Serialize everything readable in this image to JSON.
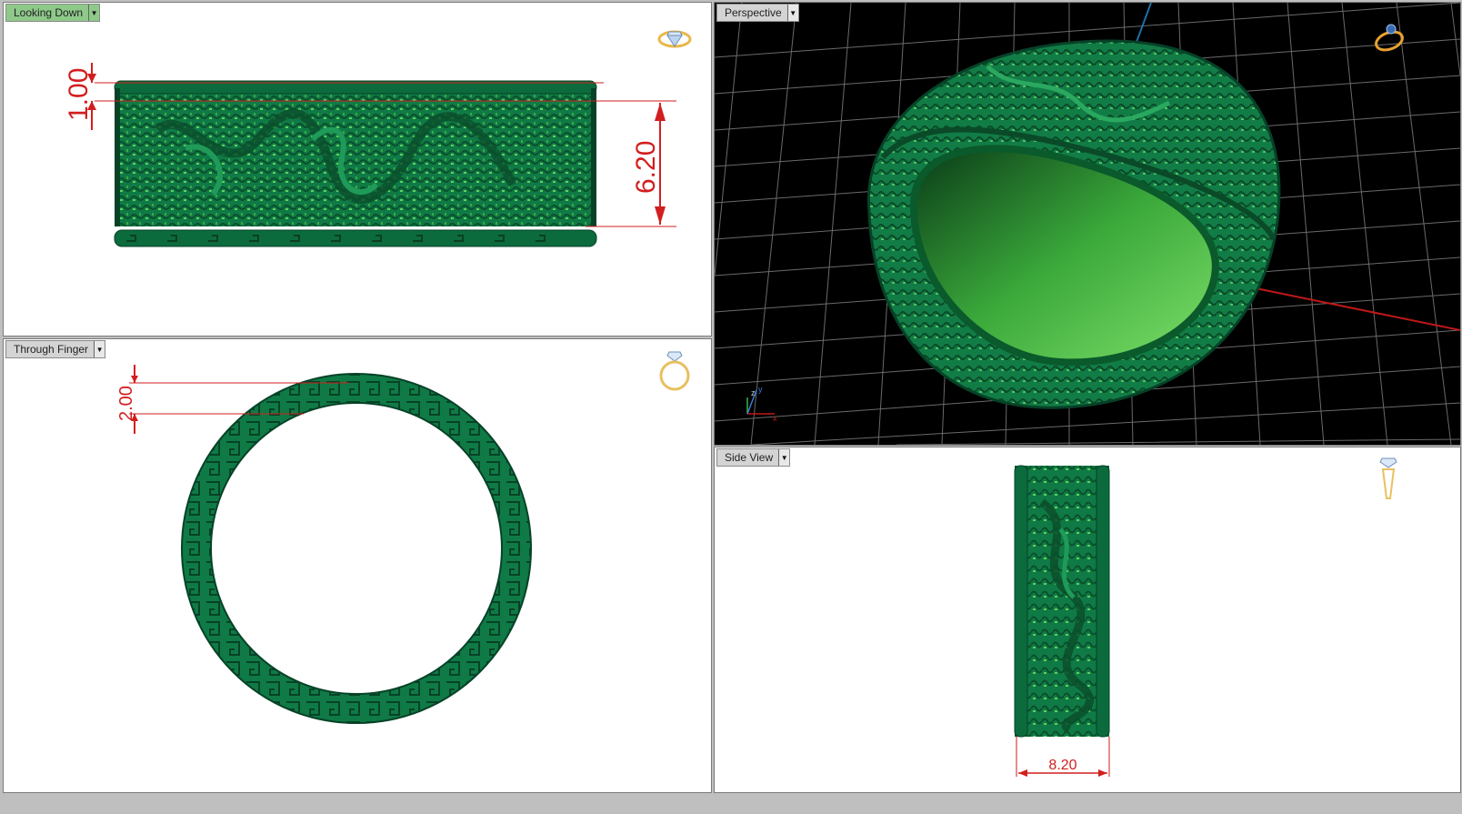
{
  "viewports": {
    "top_left": {
      "label": "Looking Down",
      "active": true
    },
    "top_right": {
      "label": "Perspective",
      "active": false
    },
    "bottom_left": {
      "label": "Through Finger",
      "active": false
    },
    "bottom_right": {
      "label": "Side View",
      "active": false
    }
  },
  "dimensions": {
    "edge_thickness": "1.00",
    "band_height": "6.20",
    "ring_thickness": "2.00",
    "band_width": "8.20"
  },
  "icons": {
    "top_left": "ring-top-view-icon",
    "top_right": "ring-perspective-icon",
    "bottom_left": "ring-front-view-icon",
    "bottom_right": "ring-side-view-icon"
  },
  "colors": {
    "model_green": "#0f7a45",
    "model_dark": "#0a4f2c",
    "model_light": "#5fd060",
    "dimension_red": "#d21e1e",
    "active_tab": "#8ec98a",
    "icon_gold": "#e8b84a"
  }
}
